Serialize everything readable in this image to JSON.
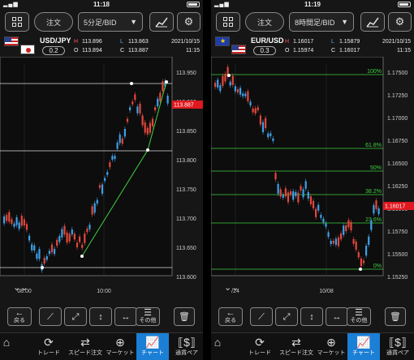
{
  "left": {
    "status_time": "11:18",
    "order_label": "注文",
    "period_label": "5分足/BID",
    "pair": "USD/JPY",
    "spread": "0.2",
    "ohlc": {
      "h_label": "H",
      "h": "113.896",
      "l_label": "L",
      "l": "113.863",
      "o_label": "O",
      "o": "113.894",
      "c_label": "C",
      "c": "113.887"
    },
    "date": "2021/10/15",
    "time": "11:15",
    "chart_data": {
      "type": "candlestick",
      "y_ticks": [
        "113.950",
        "113.900",
        "113.850",
        "113.800",
        "113.750",
        "113.700",
        "113.650",
        "113.600"
      ],
      "x_ticks": [
        "08:00",
        "10:00"
      ],
      "current_price": "113.887"
    }
  },
  "right": {
    "status_time": "11:19",
    "order_label": "注文",
    "period_label": "8時間足/BID",
    "pair": "EUR/USD",
    "spread": "0.3",
    "ohlc": {
      "h_label": "H",
      "h": "1.16017",
      "l_label": "L",
      "l": "1.15879",
      "o_label": "O",
      "o": "1.15974",
      "c_label": "C",
      "c": "1.16017"
    },
    "date": "2021/10/15",
    "time": "11:15",
    "chart_data": {
      "type": "candlestick",
      "y_ticks": [
        "1.17500",
        "1.17250",
        "1.17000",
        "1.16750",
        "1.16500",
        "1.16250",
        "1.16000",
        "1.15750",
        "1.15500",
        "1.15250"
      ],
      "x_ticks": [
        "/24",
        "10/08"
      ],
      "fib_levels": [
        "100%",
        "61.8%",
        "50%",
        "38.2%",
        "23.6%",
        "0%"
      ],
      "current_price": "1.16017"
    }
  },
  "drawbar": {
    "back_label": "戻る",
    "other_label": "その他"
  },
  "tabs": [
    "トレード",
    "スピード注文",
    "マーケット",
    "チャート",
    "通貨ペア"
  ],
  "colors": {
    "up": "#e2483d",
    "down": "#3ea0e8",
    "trend": "#3ed13e",
    "price": "#e0181f",
    "active_tab": "#1b7fd6"
  }
}
